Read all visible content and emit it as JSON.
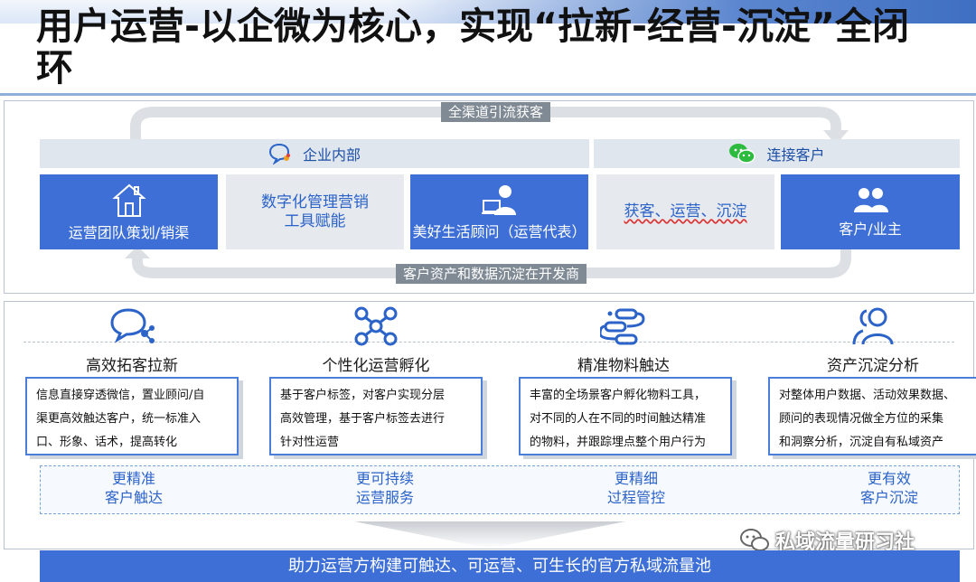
{
  "header": {
    "title": "用户运营-以企微为核心，实现“拉新-经营-沉淀”全闭环"
  },
  "loop": {
    "top_label": "全渠道引流获客",
    "bottom_label": "客户资产和数据沉淀在开发商"
  },
  "bands": {
    "left": {
      "label": "企业内部",
      "icon": "chat-bubble-icon"
    },
    "right": {
      "label": "连接客户",
      "icon": "wechat-icon"
    }
  },
  "tiles": [
    {
      "label": "运营团队策划/销渠",
      "icon": "house-icon",
      "style": "blue"
    },
    {
      "label_line1": "数字化管理营销",
      "label_line2": "工具赋能",
      "style": "grey"
    },
    {
      "label": "美好生活顾问（运营代表）",
      "icon": "advisor-icon",
      "style": "blue"
    },
    {
      "label": "获客、运营、沉淀",
      "style": "grey"
    },
    {
      "label": "客户/业主",
      "icon": "people-icon",
      "style": "blue"
    }
  ],
  "features": [
    {
      "title": "高效拓客拉新",
      "icon": "chat-network-icon",
      "desc": [
        "信息直接穿透微信，置业顾问/自",
        "渠更高效触达客户，统一标准入",
        "口、形象、话术，提高转化"
      ]
    },
    {
      "title": "个性化运营孵化",
      "icon": "node-graph-icon",
      "desc": [
        "基于客户标签，对客户实现分层",
        "高效管理，基于客户标签去进行",
        "针对性运营"
      ]
    },
    {
      "title": "精准物料触达",
      "icon": "flow-icon",
      "desc": [
        "丰富的全场景客户孵化物料工具，",
        "对不同的人在不同的时间触达精准",
        "的物料，并跟踪埋点整个用户行为"
      ]
    },
    {
      "title": "资产沉淀分析",
      "icon": "users-outline-icon",
      "desc": [
        "对整体用户数据、活动效果数据、",
        "顾问的表现情况做全方位的采集",
        "和洞察分析，沉淀自有私域资产"
      ]
    }
  ],
  "benefits": [
    {
      "line1": "更精准",
      "line2": "客户触达"
    },
    {
      "line1": "更可持续",
      "line2": "运营服务"
    },
    {
      "line1": "更精细",
      "line2": "过程管控"
    },
    {
      "line1": "更有效",
      "line2": "客户沉淀"
    }
  ],
  "watermark": {
    "text": "私域流量研习社",
    "icon": "wechat-icon"
  },
  "bottom": {
    "label": "助力运营方构建可触达、可运营、可生长的官方私域流量池"
  },
  "colors": {
    "accent": "#3d6fd6",
    "tile_grey": "#e6e9ed",
    "band": "#dfe6ee",
    "loop": "#7f8a95"
  }
}
